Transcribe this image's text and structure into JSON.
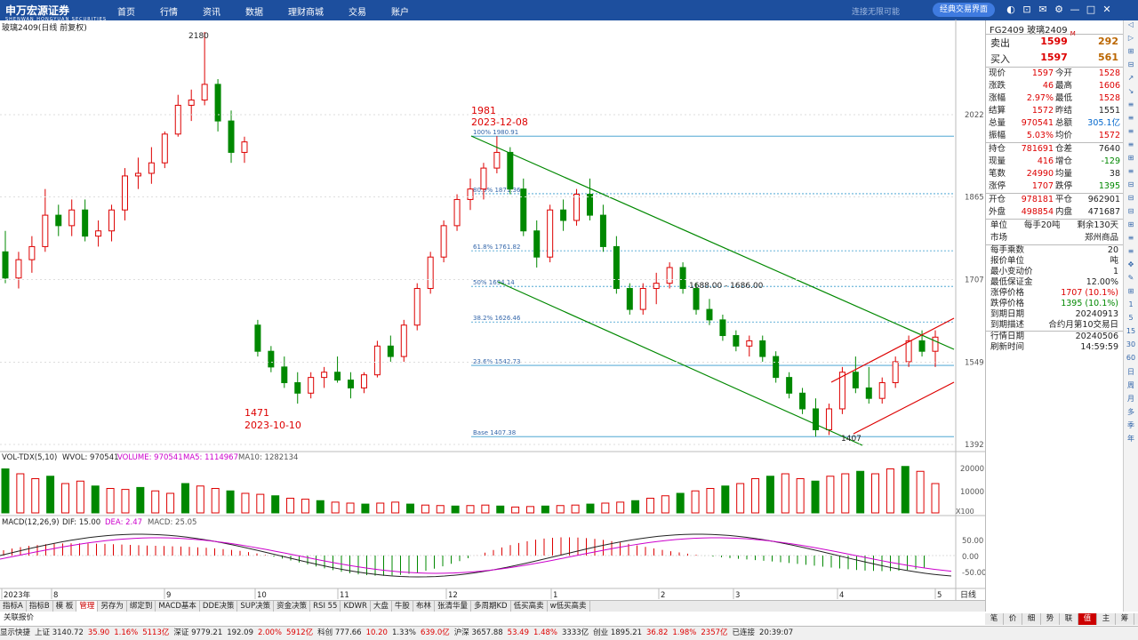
{
  "app": {
    "logo": "申万宏源证券",
    "logo_sub": "SHENWAN HONGYUAN SECURITIES",
    "nav": [
      "首页",
      "行情",
      "资讯",
      "数据",
      "理财商城",
      "交易",
      "账户"
    ],
    "slogan": "连接无限可能",
    "classic_btn": "经典交易界面",
    "win_btns": [
      "◐",
      "⊡",
      "✉",
      "⚙",
      "—",
      "□",
      "✕"
    ]
  },
  "chart_title": "玻璃2409(日线 前复权)",
  "chart_data": {
    "type": "candlestick",
    "symbol": "FG2409",
    "y_ticks": [
      2022,
      1865,
      1707,
      1549,
      1392
    ],
    "ylim": [
      1392,
      2180
    ],
    "x_ticks": [
      "2023年",
      "8",
      "9",
      "10",
      "11",
      "12",
      "1",
      "2",
      "3",
      "4",
      "5"
    ],
    "annotations": {
      "high": {
        "value": "2180"
      },
      "peak": {
        "value": "1981",
        "date": "2023-12-08"
      },
      "trough": {
        "value": "1471",
        "date": "2023-10-10"
      },
      "low": {
        "value": "1407"
      },
      "level": "1688.00 - 1686.00"
    },
    "fib": [
      {
        "label": "100% 1980.91",
        "y": 1981
      },
      {
        "label": "23.6% 1542.73",
        "y": 1543
      },
      {
        "label": "Base 1407.38",
        "y": 1407
      }
    ],
    "fib_minor": [
      {
        "label": "80.9% 1871.36",
        "y": 1871
      },
      {
        "label": "61.8% 1761.82",
        "y": 1762
      },
      {
        "label": "50% 1694.14",
        "y": 1694
      },
      {
        "label": "38.2% 1626.46",
        "y": 1626
      }
    ],
    "ohlc": [
      [
        1760,
        1800,
        1700,
        1710
      ],
      [
        1710,
        1760,
        1690,
        1745
      ],
      [
        1745,
        1790,
        1720,
        1770
      ],
      [
        1770,
        1880,
        1760,
        1830
      ],
      [
        1830,
        1850,
        1790,
        1810
      ],
      [
        1810,
        1860,
        1790,
        1840
      ],
      [
        1840,
        1860,
        1780,
        1790
      ],
      [
        1790,
        1820,
        1770,
        1800
      ],
      [
        1800,
        1850,
        1780,
        1840
      ],
      [
        1840,
        1920,
        1820,
        1905
      ],
      [
        1905,
        1940,
        1880,
        1910
      ],
      [
        1910,
        1960,
        1890,
        1930
      ],
      [
        1930,
        1990,
        1920,
        1985
      ],
      [
        1985,
        2060,
        1980,
        2040
      ],
      [
        2040,
        2070,
        2010,
        2050
      ],
      [
        2050,
        2180,
        2040,
        2080
      ],
      [
        2080,
        2090,
        1990,
        2010
      ],
      [
        2010,
        2030,
        1930,
        1950
      ],
      [
        1950,
        1980,
        1930,
        1970
      ],
      [
        1620,
        1630,
        1560,
        1570
      ],
      [
        1570,
        1580,
        1530,
        1540
      ],
      [
        1540,
        1560,
        1500,
        1510
      ],
      [
        1510,
        1530,
        1470,
        1490
      ],
      [
        1490,
        1530,
        1480,
        1520
      ],
      [
        1520,
        1540,
        1500,
        1530
      ],
      [
        1530,
        1560,
        1510,
        1515
      ],
      [
        1515,
        1530,
        1480,
        1500
      ],
      [
        1500,
        1530,
        1490,
        1525
      ],
      [
        1525,
        1590,
        1520,
        1580
      ],
      [
        1580,
        1600,
        1550,
        1560
      ],
      [
        1560,
        1630,
        1550,
        1620
      ],
      [
        1620,
        1700,
        1610,
        1690
      ],
      [
        1690,
        1760,
        1680,
        1750
      ],
      [
        1750,
        1820,
        1740,
        1810
      ],
      [
        1810,
        1870,
        1800,
        1860
      ],
      [
        1860,
        1900,
        1840,
        1880
      ],
      [
        1880,
        1930,
        1860,
        1920
      ],
      [
        1920,
        1981,
        1910,
        1950
      ],
      [
        1950,
        1960,
        1870,
        1880
      ],
      [
        1880,
        1900,
        1790,
        1800
      ],
      [
        1800,
        1820,
        1730,
        1750
      ],
      [
        1750,
        1850,
        1740,
        1840
      ],
      [
        1840,
        1860,
        1800,
        1820
      ],
      [
        1820,
        1880,
        1810,
        1870
      ],
      [
        1870,
        1900,
        1820,
        1830
      ],
      [
        1830,
        1850,
        1760,
        1770
      ],
      [
        1770,
        1790,
        1680,
        1690
      ],
      [
        1690,
        1700,
        1640,
        1650
      ],
      [
        1650,
        1700,
        1640,
        1690
      ],
      [
        1690,
        1720,
        1660,
        1700
      ],
      [
        1700,
        1740,
        1690,
        1730
      ],
      [
        1730,
        1740,
        1680,
        1690
      ],
      [
        1690,
        1700,
        1640,
        1650
      ],
      [
        1650,
        1670,
        1620,
        1630
      ],
      [
        1630,
        1640,
        1590,
        1600
      ],
      [
        1600,
        1610,
        1570,
        1580
      ],
      [
        1580,
        1600,
        1560,
        1590
      ],
      [
        1590,
        1600,
        1550,
        1560
      ],
      [
        1560,
        1570,
        1510,
        1520
      ],
      [
        1520,
        1530,
        1480,
        1490
      ],
      [
        1490,
        1500,
        1450,
        1460
      ],
      [
        1460,
        1480,
        1407,
        1420
      ],
      [
        1420,
        1470,
        1410,
        1460
      ],
      [
        1460,
        1540,
        1450,
        1530
      ],
      [
        1530,
        1560,
        1490,
        1500
      ],
      [
        1500,
        1540,
        1470,
        1480
      ],
      [
        1480,
        1520,
        1470,
        1510
      ],
      [
        1510,
        1560,
        1500,
        1550
      ],
      [
        1550,
        1600,
        1540,
        1590
      ],
      [
        1590,
        1610,
        1560,
        1570
      ],
      [
        1570,
        1610,
        1540,
        1597
      ]
    ]
  },
  "vol": {
    "header": "VOL-TDX(5,10)",
    "wvol": "WVOL: 970541",
    "volume": "VOLUME: 970541",
    "ma5": "MA5: 1114967",
    "ma10": "MA10: 1282134",
    "ticks": [
      "20000",
      "10000"
    ],
    "unit": "X100",
    "values": [
      90,
      80,
      70,
      75,
      60,
      65,
      55,
      50,
      48,
      52,
      45,
      40,
      60,
      55,
      50,
      45,
      40,
      38,
      35,
      30,
      28,
      25,
      22,
      20,
      18,
      20,
      22,
      18,
      16,
      15,
      14,
      15,
      16,
      14,
      12,
      13,
      14,
      15,
      16,
      18,
      20,
      22,
      25,
      30,
      35,
      40,
      45,
      50,
      55,
      60,
      70,
      75,
      80,
      70,
      65,
      75,
      80,
      85,
      80,
      90,
      95,
      85,
      60
    ]
  },
  "macd": {
    "header": "MACD(12,26,9)",
    "dif": "DIF: 15.00",
    "dea": "DEA: 2.47",
    "macd": "MACD: 25.05",
    "ticks": [
      "50.00",
      "0.00",
      "-50.00"
    ]
  },
  "tabs": [
    "指标A",
    "指标B",
    "模 板",
    "管理",
    "另存为",
    "绑定到",
    "MACD基本",
    "DDE决策",
    "SUP决策",
    "资金决策",
    "RSI 55",
    "KDWR",
    "大盘",
    "牛股",
    "布林",
    "张清华量",
    "多周期KD",
    "低买高卖",
    "w低买高卖"
  ],
  "period_btn": "日线",
  "rel_quote": "关联报价",
  "quote": {
    "title": "FG2409 玻璃2409",
    "badge": "M",
    "ask": {
      "label": "卖出",
      "price": "1599",
      "vol": "292"
    },
    "bid": {
      "label": "买入",
      "price": "1597",
      "vol": "561"
    },
    "grid1": [
      [
        "现价",
        "1597",
        "今开",
        "1528"
      ],
      [
        "涨跌",
        "46",
        "最高",
        "1606"
      ],
      [
        "涨幅",
        "2.97%",
        "最低",
        "1528"
      ],
      [
        "结算",
        "1572",
        "昨结",
        "1551"
      ],
      [
        "总量",
        "970541",
        "总额",
        "305.1亿"
      ],
      [
        "振幅",
        "5.03%",
        "均价",
        "1572"
      ]
    ],
    "grid2": [
      [
        "持仓",
        "781691",
        "仓差",
        "7640"
      ],
      [
        "现量",
        "416",
        "增仓",
        "-129"
      ],
      [
        "笔数",
        "24990",
        "均量",
        "38"
      ],
      [
        "涨停",
        "1707",
        "跌停",
        "1395"
      ]
    ],
    "grid3": [
      [
        "开仓",
        "978181",
        "平仓",
        "962901"
      ],
      [
        "外盘",
        "498854",
        "内盘",
        "471687"
      ]
    ],
    "unit_row": [
      "单位",
      "每手20吨",
      "剩余130天"
    ],
    "market_row": [
      "市场",
      "郑州商品"
    ],
    "specs": [
      [
        "每手乘数",
        "20"
      ],
      [
        "报价单位",
        "吨"
      ],
      [
        "最小变动价",
        "1"
      ],
      [
        "最低保证金",
        "12.00%"
      ],
      [
        "涨停价格",
        "1707 (10.1%)"
      ],
      [
        "跌停价格",
        "1395 (10.1%)"
      ],
      [
        "到期日期",
        "20240913"
      ],
      [
        "到期描述",
        "合约月第10交易日"
      ]
    ],
    "dates": [
      [
        "行情日期",
        "20240506"
      ],
      [
        "刷新时间",
        "14:59:59"
      ]
    ],
    "tabs": [
      "笔",
      "价",
      "细",
      "势",
      "联",
      "值",
      "主",
      "筹"
    ]
  },
  "rstrip": [
    "◁",
    "▷",
    "⊞",
    "⊟",
    "↗",
    "↘",
    "≡",
    "≡",
    "≡",
    "≡",
    "⊞",
    "≡",
    "⊟",
    "⊟",
    "⊟",
    "⊞",
    "≡",
    "≡",
    "✥",
    "✎",
    "⊞",
    "1",
    "5",
    "15",
    "30",
    "60",
    "日",
    "周",
    "月",
    "多",
    "季",
    "年"
  ],
  "status": {
    "items": [
      "显示快捷",
      "上证 3140.72",
      "35.90",
      "1.16%",
      "5113亿",
      "深证 9779.21",
      "192.09",
      "2.00%",
      "5912亿",
      "科创 777.66",
      "10.20",
      "1.33%",
      "639.0亿",
      "沪深 3657.88",
      "53.49",
      "1.48%",
      "3333亿",
      "创业 1895.21",
      "36.82",
      "1.98%",
      "2357亿",
      "已连接",
      "20:39:07"
    ]
  }
}
